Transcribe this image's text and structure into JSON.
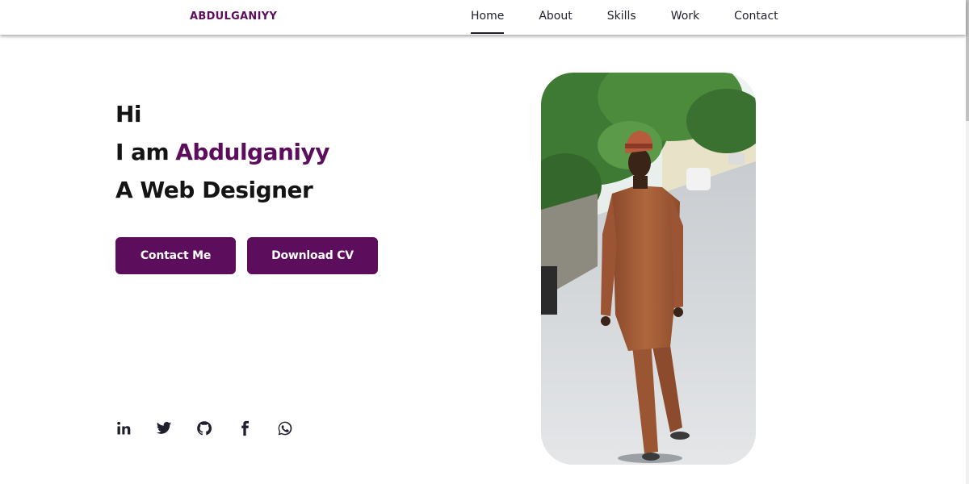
{
  "header": {
    "logo": "ABDULGANIYY",
    "nav": [
      {
        "label": "Home",
        "active": true
      },
      {
        "label": "About",
        "active": false
      },
      {
        "label": "Skills",
        "active": false
      },
      {
        "label": "Work",
        "active": false
      },
      {
        "label": "Contact",
        "active": false
      }
    ]
  },
  "hero": {
    "greeting": "Hi",
    "intro_prefix": "I am",
    "name": "Abdulganiyy",
    "role": "A Web Designer",
    "buttons": {
      "contact": "Contact Me",
      "download": "Download CV"
    }
  },
  "socials": [
    {
      "icon": "linkedin-icon"
    },
    {
      "icon": "twitter-icon"
    },
    {
      "icon": "github-icon"
    },
    {
      "icon": "facebook-icon"
    },
    {
      "icon": "whatsapp-icon"
    }
  ],
  "colors": {
    "accent": "#5c0d5c",
    "text": "#141414",
    "nav_text": "#1f1f2e"
  }
}
